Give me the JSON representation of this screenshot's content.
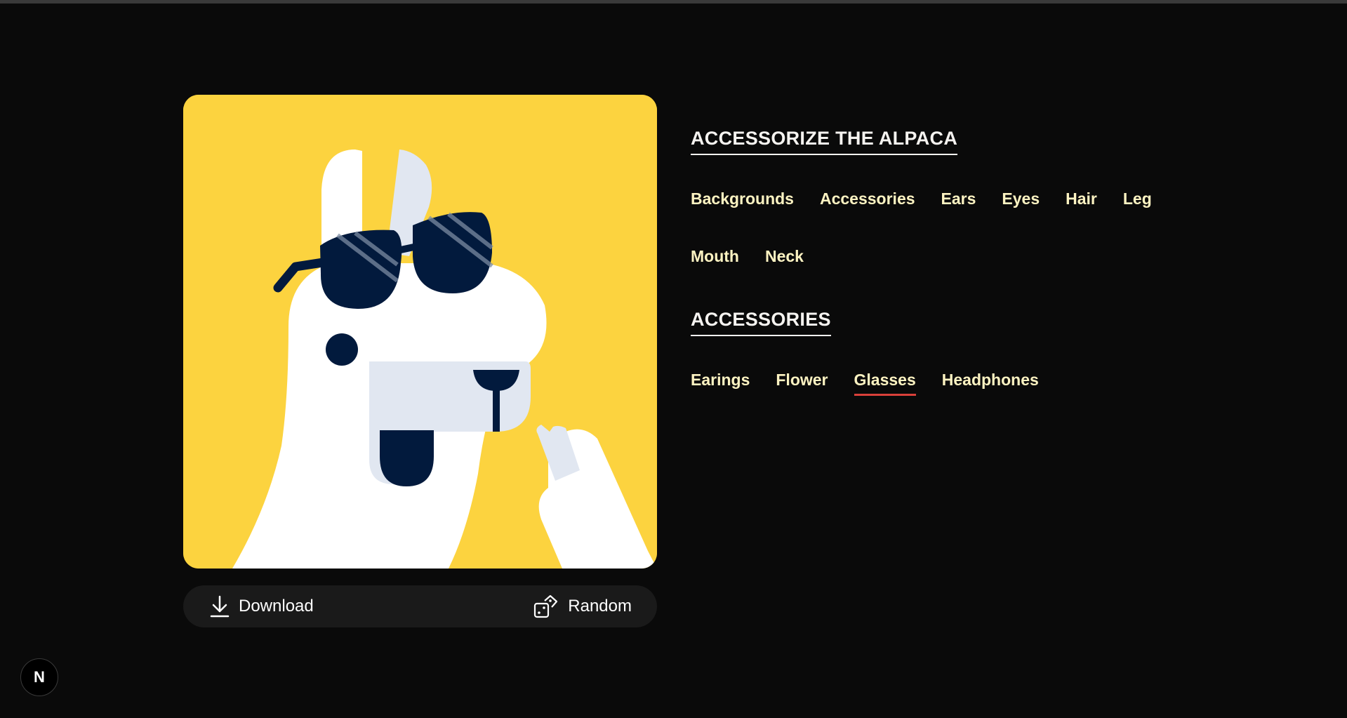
{
  "canvas": {
    "background_color": "#fcd33f",
    "alpaca_color": "#ffffff",
    "accent_color": "#e1e7f1",
    "dark_color": "#021a3d",
    "current_accessory": "glasses"
  },
  "actions": {
    "download_label": "Download",
    "download_icon": "download-icon",
    "random_label": "Random",
    "random_icon": "dice-icon"
  },
  "panel": {
    "title": "ACCESSORIZE THE ALPACA",
    "parts": [
      {
        "label": "Backgrounds"
      },
      {
        "label": "Accessories"
      },
      {
        "label": "Ears"
      },
      {
        "label": "Eyes"
      },
      {
        "label": "Hair"
      },
      {
        "label": "Leg"
      },
      {
        "label": "Mouth"
      },
      {
        "label": "Neck"
      }
    ],
    "section_title": "ACCESSORIES",
    "styles": [
      {
        "label": "Earings"
      },
      {
        "label": "Flower"
      },
      {
        "label": "Glasses",
        "active": true
      },
      {
        "label": "Headphones"
      }
    ],
    "active_underline_color": "#d9403a"
  },
  "badge": {
    "letter": "N"
  }
}
